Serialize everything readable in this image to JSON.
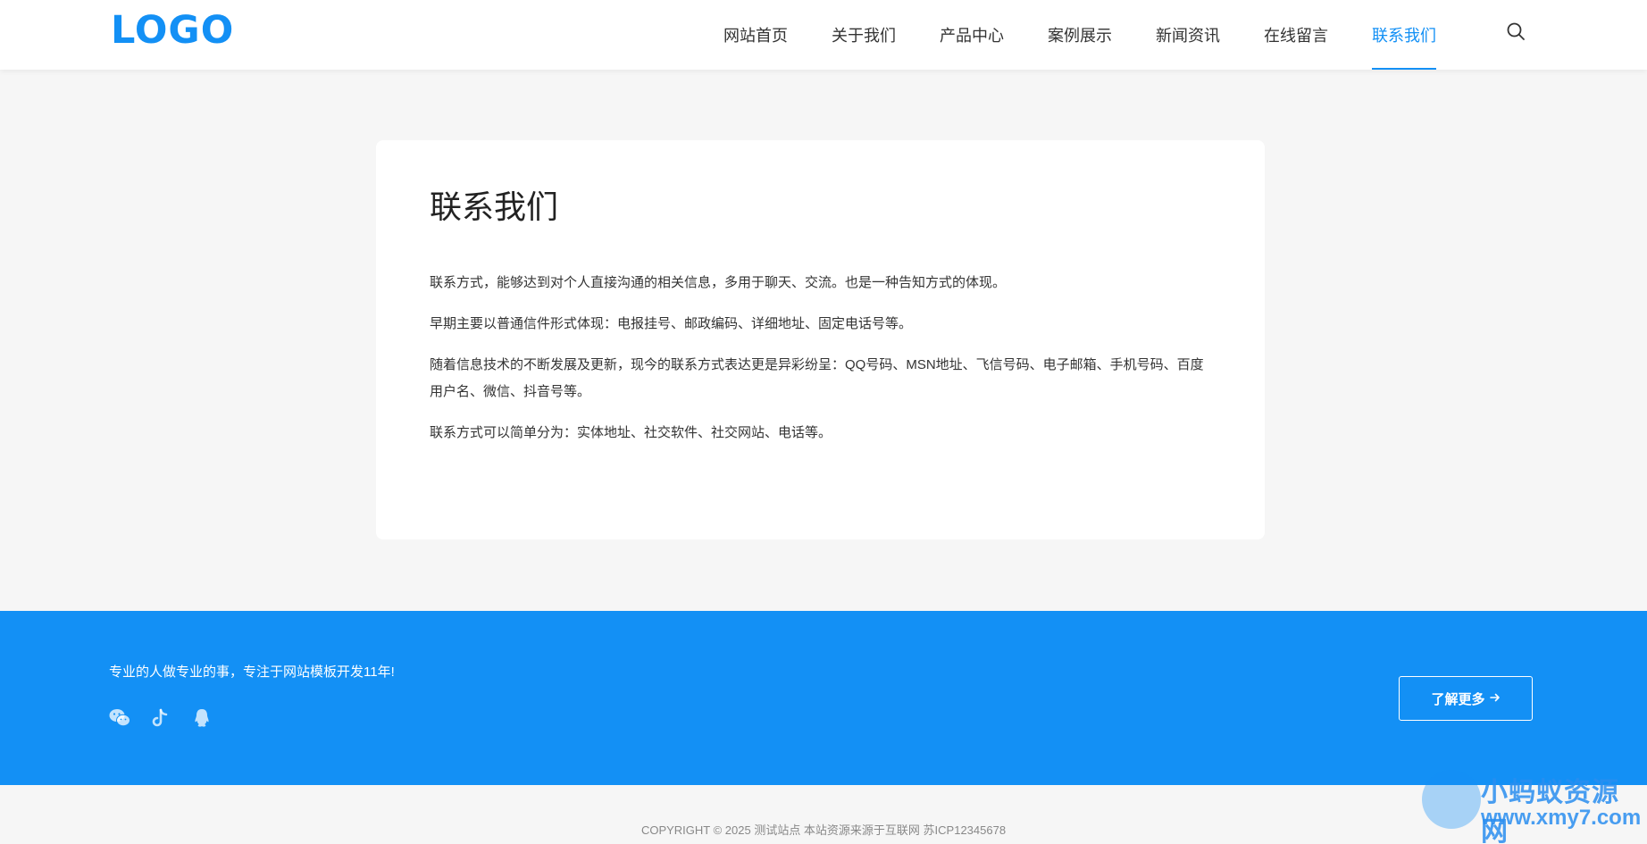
{
  "header": {
    "logo_text": "LOGO",
    "nav": [
      {
        "label": "网站首页"
      },
      {
        "label": "关于我们"
      },
      {
        "label": "产品中心"
      },
      {
        "label": "案例展示"
      },
      {
        "label": "新闻资讯"
      },
      {
        "label": "在线留言"
      },
      {
        "label": "联系我们",
        "active": true
      }
    ],
    "search_icon": "search-icon"
  },
  "content": {
    "title": "联系我们",
    "paragraphs": [
      "联系方式，能够达到对个人直接沟通的相关信息，多用于聊天、交流。也是一种告知方式的体现。",
      "早期主要以普通信件形式体现：电报挂号、邮政编码、详细地址、固定电话号等。",
      "随着信息技术的不断发展及更新，现今的联系方式表达更是异彩纷呈：QQ号码、MSN地址、飞信号码、电子邮箱、手机号码、百度用户名、微信、抖音号等。",
      "联系方式可以简单分为：实体地址、社交软件、社交网站、电话等。"
    ]
  },
  "footer": {
    "slogan": "专业的人做专业的事，专注于网站模板开发11年!",
    "social_icons": [
      "wechat-icon",
      "tiktok-icon",
      "qq-icon"
    ],
    "more_button": "了解更多",
    "copyright": "COPYRIGHT © 2025 测试站点 本站资源来源于互联网 苏ICP12345678"
  },
  "watermark": {
    "title": "小蚂蚁资源网",
    "url": "www.xmy7.com"
  },
  "colors": {
    "accent": "#1390f5",
    "page_bg": "#f6f6f6",
    "card_bg": "#ffffff"
  }
}
